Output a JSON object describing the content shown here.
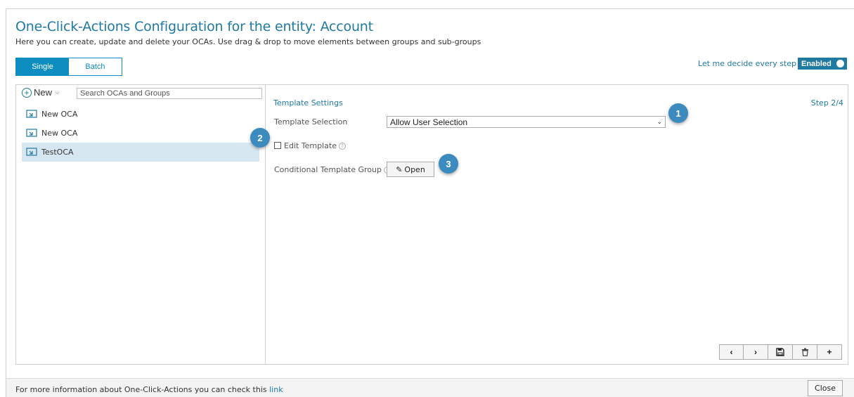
{
  "header": {
    "title": "One-Click-Actions Configuration for the entity: Account",
    "subtitle": "Here you can create, update and delete your OCAs. Use drag & drop to move elements between groups and sub-groups"
  },
  "mode_toggle": {
    "single": "Single",
    "batch": "Batch",
    "active": "single"
  },
  "decide": {
    "label": "Let me decide every step",
    "badge": "Enabled",
    "enabled": true
  },
  "sidebar": {
    "new_label": "New",
    "search_placeholder": "Search OCAs and Groups",
    "items": [
      {
        "label": "New OCA",
        "icon": "oca-icon",
        "selected": false
      },
      {
        "label": "New OCA",
        "icon": "oca-icon",
        "selected": false
      },
      {
        "label": "TestOCA",
        "icon": "oca-icon",
        "selected": true
      }
    ]
  },
  "settings": {
    "section_title": "Template Settings",
    "step": "Step 2/4",
    "template_selection_label": "Template Selection",
    "template_selection_value": "Allow User Selection",
    "edit_template_label": "Edit Template",
    "edit_template_checked": false,
    "conditional_label": "Conditional Template Group",
    "open_label": "Open"
  },
  "markers": [
    "1",
    "2",
    "3"
  ],
  "toolbar": {
    "prev": "‹",
    "next": "›",
    "save_icon": "save-icon",
    "delete_icon": "trash-icon",
    "add": "+"
  },
  "footer": {
    "text": "For more information about One-Click-Actions you can check this",
    "link": "link",
    "close": "Close"
  },
  "colors": {
    "accent": "#1f7aa3",
    "toggle": "#0e8dc0",
    "selected_row": "#d7e7f2",
    "marker": "#3b8bbf"
  }
}
